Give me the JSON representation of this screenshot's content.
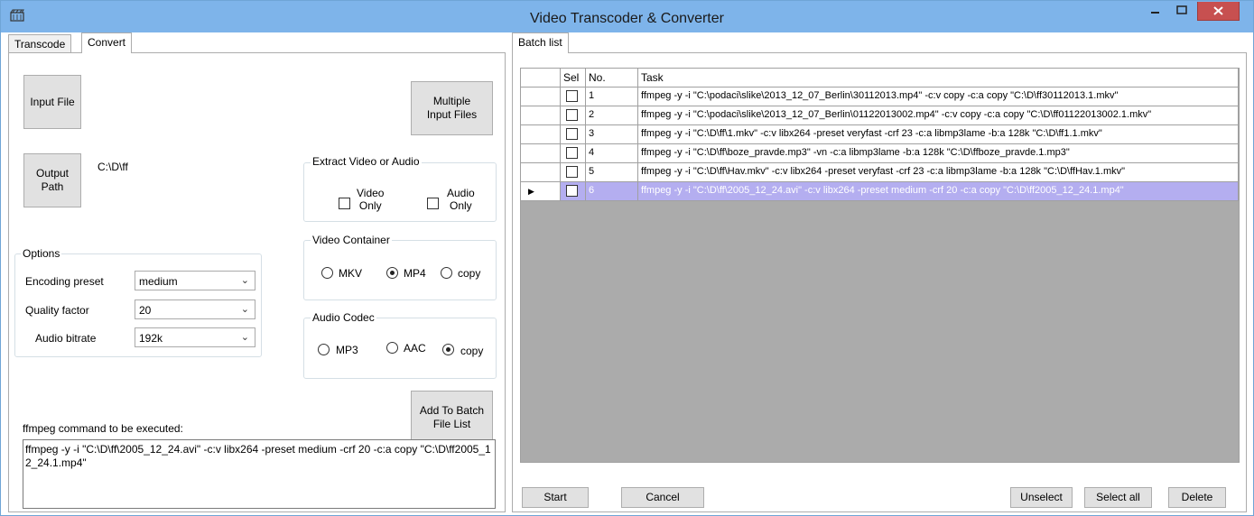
{
  "window": {
    "title": "Video Transcoder & Converter",
    "icon": "clapperboard-icon",
    "controls": [
      "minimize-icon",
      "maximize-icon",
      "close-icon"
    ]
  },
  "left_tabs": [
    "Transcode",
    "Convert"
  ],
  "active_left_tab": "Convert",
  "convert": {
    "input_file_label": "Input File",
    "multiple_input_label": "Multiple\nInput Files",
    "output_path_label": "Output\nPath",
    "output_path_value": "C:\\D\\ff",
    "extract_group": {
      "title": "Extract Video or Audio",
      "video_only": "Video\nOnly",
      "audio_only": "Audio\nOnly"
    },
    "container_group": {
      "title": "Video Container",
      "options": [
        "MKV",
        "MP4",
        "copy"
      ],
      "selected": "MP4"
    },
    "codec_group": {
      "title": "Audio Codec",
      "options": [
        "MP3",
        "AAC",
        "copy"
      ],
      "selected": "copy"
    },
    "options_group": {
      "title": "Options",
      "encoding_preset_label": "Encoding preset",
      "encoding_preset_value": "medium",
      "quality_label": "Quality factor",
      "quality_value": "20",
      "bitrate_label": "Audio bitrate",
      "bitrate_value": "192k"
    },
    "add_batch_label": "Add To Batch\nFile List",
    "command_label": "ffmpeg command to be executed:",
    "command_value": "ffmpeg -y -i \"C:\\D\\ff\\2005_12_24.avi\" -c:v libx264 -preset medium -crf 20 -c:a copy \"C:\\D\\ff2005_12_24.1.mp4\""
  },
  "batch": {
    "tab_label": "Batch list",
    "columns": [
      "Sel",
      "No.",
      "Task"
    ],
    "rows": [
      {
        "no": "1",
        "task": "ffmpeg -y -i \"C:\\podaci\\slike\\2013_12_07_Berlin\\30112013.mp4\" -c:v copy -c:a copy \"C:\\D\\ff30112013.1.mkv\""
      },
      {
        "no": "2",
        "task": "ffmpeg -y -i \"C:\\podaci\\slike\\2013_12_07_Berlin\\01122013002.mp4\" -c:v copy -c:a copy \"C:\\D\\ff01122013002.1.mkv\""
      },
      {
        "no": "3",
        "task": "ffmpeg -y -i \"C:\\D\\ff\\1.mkv\" -c:v libx264 -preset veryfast -crf 23 -c:a libmp3lame -b:a 128k \"C:\\D\\ff1.1.mkv\""
      },
      {
        "no": "4",
        "task": "ffmpeg -y -i \"C:\\D\\ff\\boze_pravde.mp3\" -vn -c:a libmp3lame -b:a 128k \"C:\\D\\ffboze_pravde.1.mp3\""
      },
      {
        "no": "5",
        "task": "ffmpeg -y -i \"C:\\D\\ff\\Hav.mkv\" -c:v libx264 -preset veryfast -crf 23 -c:a libmp3lame -b:a 128k \"C:\\D\\ffHav.1.mkv\""
      },
      {
        "no": "6",
        "task": "ffmpeg -y -i \"C:\\D\\ff\\2005_12_24.avi\" -c:v libx264 -preset medium -crf 20 -c:a copy \"C:\\D\\ff2005_12_24.1.mp4\""
      }
    ],
    "selected_row": 6,
    "start_label": "Start",
    "cancel_label": "Cancel",
    "unselect_label": "Unselect",
    "select_all_label": "Select all",
    "delete_label": "Delete"
  }
}
